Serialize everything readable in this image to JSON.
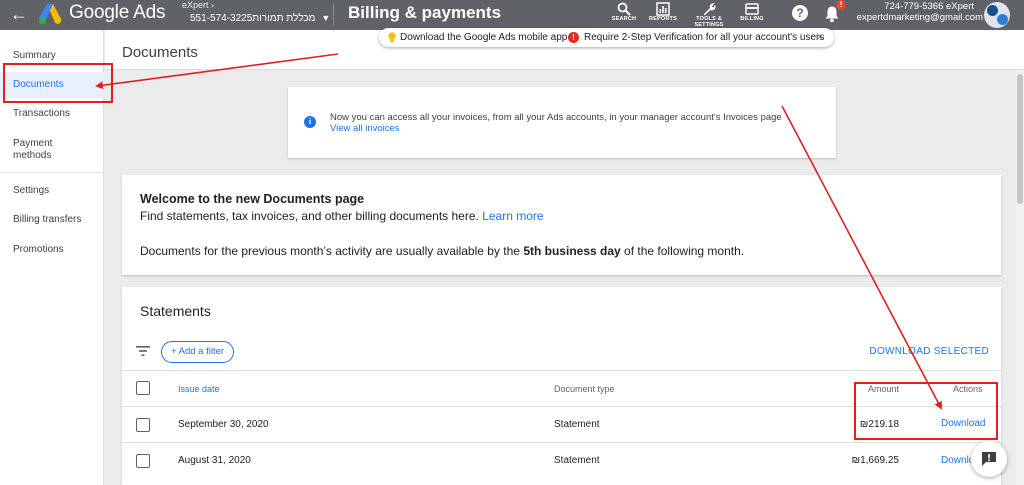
{
  "topbar": {
    "app_name": "Google Ads",
    "account_top": "eXpert",
    "account_name": "מכללת תמורות",
    "account_number": "551-574-3225",
    "page_title": "Billing & payments",
    "tools": [
      {
        "label": "SEARCH",
        "icon": "search-icon"
      },
      {
        "label": "REPORTS",
        "icon": "reports-icon"
      },
      {
        "label": "TOOLS & SETTINGS",
        "icon": "wrench-icon"
      },
      {
        "label": "BILLING",
        "icon": "billing-icon"
      }
    ],
    "help_glyph": "?",
    "notification_badge": "!",
    "user_id": "724-779-5366 eXpert",
    "user_email": "expertdmarketing@gmail.com"
  },
  "notifications": {
    "message_1": "Download the Google Ads mobile app",
    "message_2": "Require 2-Step Verification for all your account's users",
    "close": "×"
  },
  "sidebar": {
    "items": [
      {
        "label": "Summary",
        "active": false
      },
      {
        "label": "Documents",
        "active": true
      },
      {
        "label": "Transactions",
        "active": false
      },
      {
        "label": "Payment methods",
        "active": false
      },
      {
        "label": "Settings",
        "active": false
      },
      {
        "label": "Billing transfers",
        "active": false
      },
      {
        "label": "Promotions",
        "active": false
      }
    ]
  },
  "main": {
    "title": "Documents",
    "info": {
      "text": "Now you can access all your invoices, from all your Ads accounts, in your manager account's Invoices page",
      "link": "View all invoices"
    },
    "welcome": {
      "title": "Welcome to the new Documents page",
      "line1": "Find statements, tax invoices, and other billing documents here.",
      "learn_more": "Learn more",
      "line2_start": "Documents for the previous month’s activity are usually available by the",
      "line2_bold": "5th business day",
      "line2_end": "of the following month."
    },
    "statements": {
      "title": "Statements",
      "add_filter": "+ Add a filter",
      "download_selected": "DOWNLOAD SELECTED",
      "columns": {
        "issue_date": "Issue date",
        "document_type": "Document type",
        "amount": "Amount",
        "actions": "Actions"
      },
      "rows": [
        {
          "date": "September 30, 2020",
          "type": "Statement",
          "amount": "₪219.18",
          "action": "Download"
        },
        {
          "date": "August 31, 2020",
          "type": "Statement",
          "amount": "₪1,669.25",
          "action": "Download"
        }
      ]
    }
  },
  "colors": {
    "topbar": "#5f6368",
    "accent": "#1a73e8",
    "annotation": "#e02020"
  }
}
